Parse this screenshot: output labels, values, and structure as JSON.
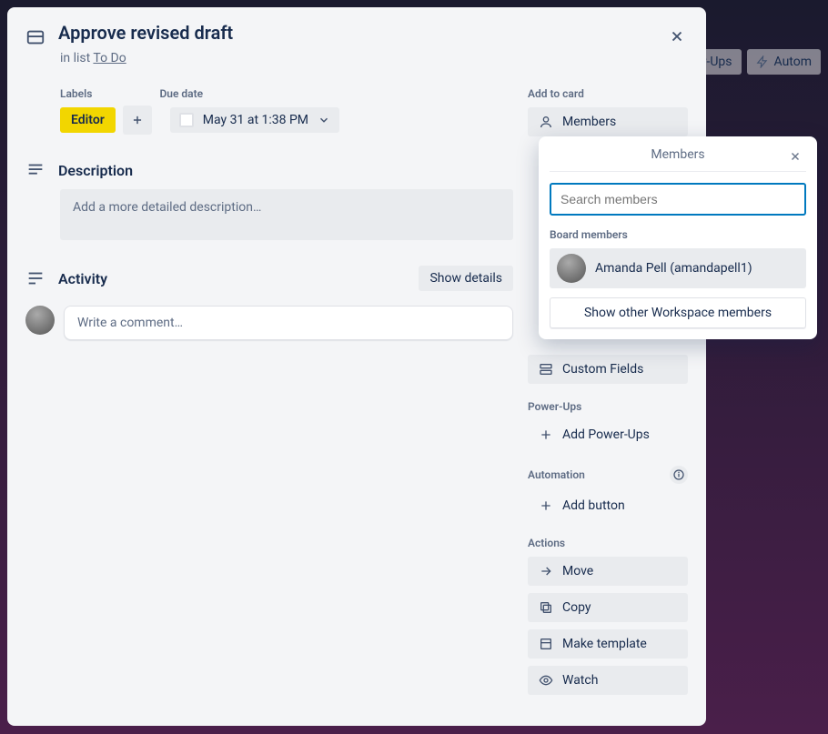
{
  "card": {
    "title": "Approve revised draft",
    "in_list_prefix": "in list ",
    "list_name": "To Do"
  },
  "labels": {
    "heading": "Labels",
    "items": [
      "Editor"
    ]
  },
  "due": {
    "heading": "Due date",
    "text": "May 31 at 1:38 PM"
  },
  "description": {
    "heading": "Description",
    "placeholder": "Add a more detailed description…"
  },
  "activity": {
    "heading": "Activity",
    "show_details": "Show details",
    "comment_placeholder": "Write a comment…"
  },
  "sidebar": {
    "add_to_card": "Add to card",
    "members": "Members",
    "custom_fields": "Custom Fields",
    "powerups_heading": "Power-Ups",
    "add_powerups": "Add Power-Ups",
    "automation_heading": "Automation",
    "add_button": "Add button",
    "actions_heading": "Actions",
    "move": "Move",
    "copy": "Copy",
    "make_template": "Make template",
    "watch": "Watch"
  },
  "popover": {
    "title": "Members",
    "search_placeholder": "Search members",
    "board_members_heading": "Board members",
    "member_name": "Amanda Pell (amandapell1)",
    "show_other": "Show other Workspace members"
  },
  "bg": {
    "powerups": "er-Ups",
    "automation": "Autom"
  }
}
